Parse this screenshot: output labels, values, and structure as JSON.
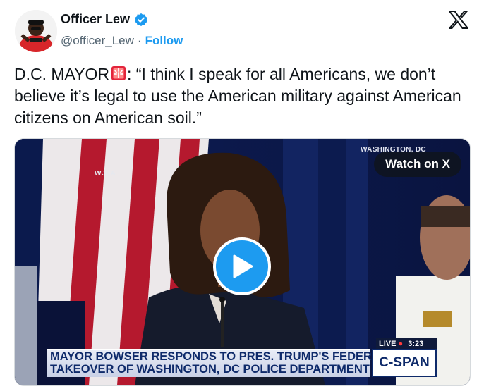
{
  "author": {
    "display_name": "Officer Lew",
    "handle": "@officer_Lew",
    "separator": "·",
    "follow_label": "Follow",
    "verified": true
  },
  "tweet": {
    "text_before_emoji": "D.C. MAYOR",
    "emoji": "rotating-light",
    "text_after_emoji": ": “I think I speak for all Americans, we don’t believe it’s legal to use the American military against American citizens on American soil.”"
  },
  "media": {
    "watch_label": "Watch on X",
    "station_logo": "WJLA",
    "location_tag": "WASHINGTON, DC",
    "chyron_line1": "MAYOR BOWSER RESPONDS TO PRES. TRUMP'S FEDERAL",
    "chyron_line2": "TAKEOVER OF WASHINGTON, DC POLICE DEPARTMENT",
    "live_label": "LIVE",
    "live_time": "3:23",
    "network": "C-SPAN"
  },
  "colors": {
    "accent": "#1d9bf0",
    "text": "#0f1419",
    "muted": "#536471"
  }
}
